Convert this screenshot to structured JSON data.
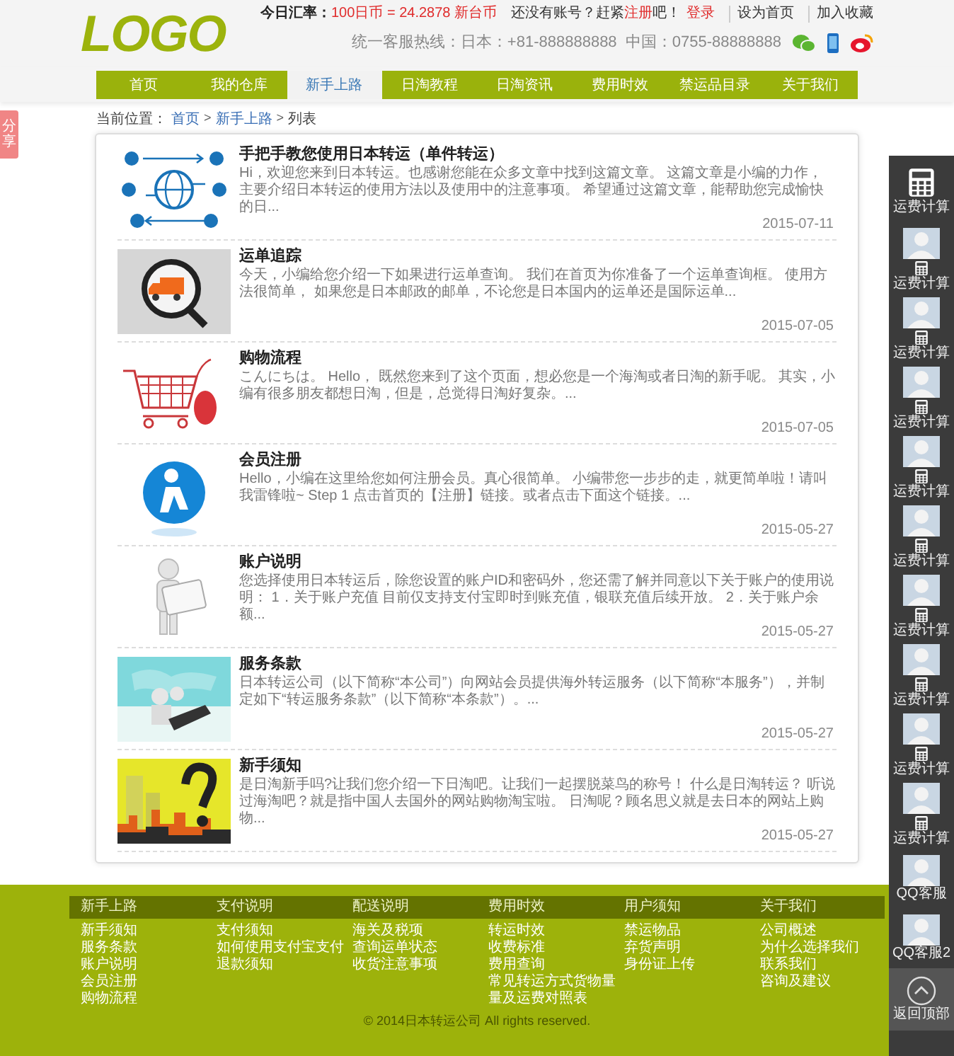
{
  "header": {
    "logo": "LOGO",
    "rate_label": "今日汇率：",
    "rate_value": "100日币 = 24.2878 新台币",
    "account_prompt": "还没有账号？赶紧",
    "register_link": "注册",
    "prompt_end": "吧！",
    "login_link": "登录",
    "set_home_link": "设为首页",
    "bookmark_link": "加入收藏",
    "hotline": "统一客服热线：日本：+81-888888888  中国：0755-88888888"
  },
  "nav": [
    {
      "label": "首页",
      "selected": false
    },
    {
      "label": "我的仓库",
      "selected": false
    },
    {
      "label": "新手上路",
      "selected": true
    },
    {
      "label": "日淘教程",
      "selected": false
    },
    {
      "label": "日淘资讯",
      "selected": false
    },
    {
      "label": "费用时效",
      "selected": false
    },
    {
      "label": "禁运品目录",
      "selected": false
    },
    {
      "label": "关于我们",
      "selected": false
    }
  ],
  "share_tab": "分享",
  "breadcrumb": [
    {
      "kind": "label",
      "text": "当前位置："
    },
    {
      "kind": "link",
      "text": "首页"
    },
    {
      "kind": "sep",
      "text": ">"
    },
    {
      "kind": "link",
      "text": "新手上路"
    },
    {
      "kind": "sep",
      "text": ">"
    },
    {
      "kind": "current",
      "text": "列表"
    }
  ],
  "articles": [
    {
      "kind": "diagram",
      "title": "手把手教您使用日本转运（单件转运）",
      "summary": "Hi，欢迎您来到日本转运。也感谢您能在众多文章中找到这篇文章。 这篇文章是小编的力作，主要介绍日本转运的使用方法以及使用中的注意事项。 希望通过这篇文章，能帮助您完成愉快的日...",
      "date": "2015-07-11"
    },
    {
      "kind": "magnifier",
      "title": "运单追踪",
      "summary": "今天，小编给您介绍一下如果进行运单查询。 我们在首页为你准备了一个运单查询框。 使用方法很简单， 如果您是日本邮政的邮单，不论您是日本国内的运单还是国际运单...",
      "date": "2015-07-05"
    },
    {
      "kind": "cart",
      "title": "购物流程",
      "summary": "こんにちは。 Hello， 既然您来到了这个页面，想必您是一个海淘或者日淘的新手呢。 其实，小编有很多朋友都想日淘，但是，总觉得日淘好复杂。...",
      "date": "2015-07-05"
    },
    {
      "kind": "sphere",
      "title": "会员注册",
      "summary": "Hello，小编在这里给您如何注册会员。真心很简单。 小编带您一步步的走，就更简单啦！请叫我雷锋啦~ Step 1 点击首页的【注册】链接。或者点击下面这个链接。...",
      "date": "2015-05-27"
    },
    {
      "kind": "figure",
      "title": "账户说明",
      "summary": "您选择使用日本转运后，除您设置的账户ID和密码外，您还需了解并同意以下关于账户的使用说明： 1．关于账户充值 目前仅支持支付宝即时到账充值，银联充值后续开放。 2．关于账户余额...",
      "date": "2015-05-27"
    },
    {
      "kind": "picture",
      "title": "服务条款",
      "summary": "日本转运公司（以下简称“本公司”）向网站会员提供海外转运服务（以下简称“本服务”），并制定如下“转运服务条款”（以下简称“本条款”）。...",
      "date": "2015-05-27"
    },
    {
      "kind": "picture",
      "title": "新手须知",
      "summary": "是日淘新手吗?让我们您介绍一下日淘吧。让我们一起摆脱菜鸟的称号！ 什么是日淘转运？ 听说过海淘吧？就是指中国人去国外的网站购物淘宝啦。 日淘呢？顾名思义就是去日本的网站上购物...",
      "date": "2015-05-27"
    }
  ],
  "footer": {
    "columns": [
      {
        "heading": "新手上路",
        "links": [
          "新手须知",
          "服务条款",
          "账户说明",
          "会员注册",
          "购物流程"
        ]
      },
      {
        "heading": "支付说明",
        "links": [
          "支付须知",
          "如何使用支付宝支付",
          "退款须知"
        ]
      },
      {
        "heading": "配送说明",
        "links": [
          "海关及税项",
          "查询运单状态",
          "收货注意事项"
        ]
      },
      {
        "heading": "费用时效",
        "links": [
          "转运时效",
          "收费标准",
          "费用查询",
          "常见转运方式货物量",
          "量及运费对照表"
        ]
      },
      {
        "heading": "用户须知",
        "links": [
          "禁运物品",
          "弃货声明",
          "身份证上传"
        ]
      },
      {
        "heading": "关于我们",
        "links": [
          "公司概述",
          "为什么选择我们",
          "联系我们",
          "咨询及建议"
        ]
      }
    ],
    "copyright": "© 2014日本转运公司 All rights reserved."
  },
  "sidebar": [
    {
      "kind": "calculator",
      "label": "运费计算"
    },
    {
      "kind": "agent",
      "label": "运费计算"
    },
    {
      "kind": "agent",
      "label": "运费计算"
    },
    {
      "kind": "agent",
      "label": "运费计算"
    },
    {
      "kind": "agent",
      "label": "运费计算"
    },
    {
      "kind": "agent",
      "label": "运费计算"
    },
    {
      "kind": "agent",
      "label": "运费计算"
    },
    {
      "kind": "agent",
      "label": "运费计算"
    },
    {
      "kind": "agent",
      "label": "运费计算"
    },
    {
      "kind": "agent",
      "label": "运费计算"
    },
    {
      "kind": "qq",
      "label": "QQ客服"
    },
    {
      "kind": "qq",
      "label": "QQ客服2"
    },
    {
      "kind": "top",
      "label": "返回顶部"
    }
  ]
}
